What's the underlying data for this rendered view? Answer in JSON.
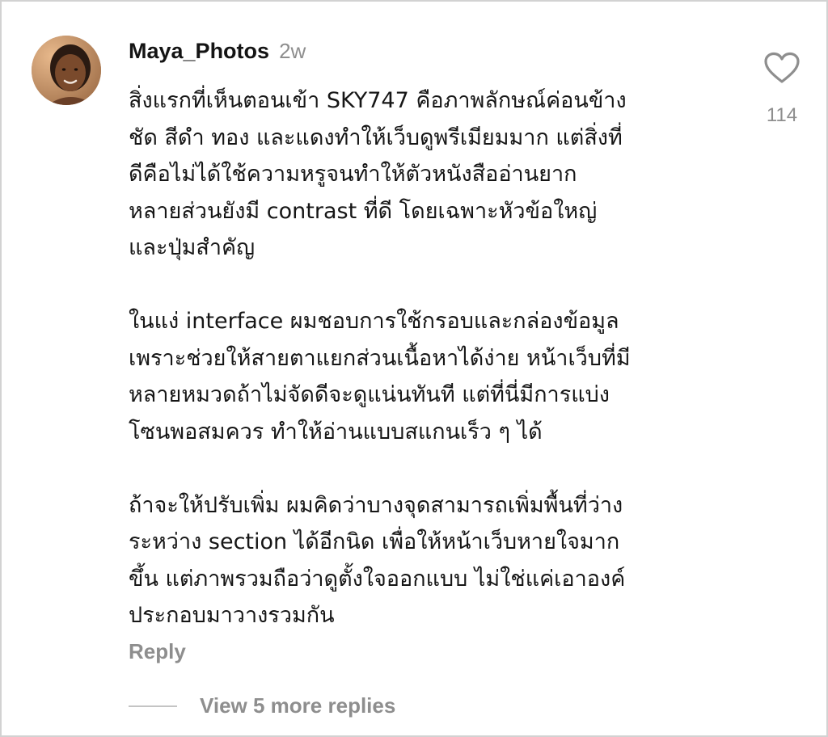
{
  "comment": {
    "username": "Maya_Photos",
    "timestamp": "2w",
    "avatar_icon": "user-avatar-photo",
    "paragraphs": [
      [
        "สิ่งแรกที่เห็นตอนเข้า SKY747 คือภาพลักษณ์ค่อนข้าง",
        "ชัด สีดำ ทอง และแดงทำให้เว็บดูพรีเมียมมาก แต่สิ่งที่",
        "ดีคือไม่ได้ใช้ความหรูจนทำให้ตัวหนังสืออ่านยาก",
        "หลายส่วนยังมี contrast ที่ดี โดยเฉพาะหัวข้อใหญ่",
        "และปุ่มสำคัญ"
      ],
      [
        "ในแง่ interface ผมชอบการใช้กรอบและกล่องข้อมูล",
        "เพราะช่วยให้สายตาแยกส่วนเนื้อหาได้ง่าย หน้าเว็บที่มี",
        "หลายหมวดถ้าไม่จัดดีจะดูแน่นทันที แต่ที่นี่มีการแบ่ง",
        "โซนพอสมควร ทำให้อ่านแบบสแกนเร็ว ๆ ได้"
      ],
      [
        "ถ้าจะให้ปรับเพิ่ม ผมคิดว่าบางจุดสามารถเพิ่มพื้นที่ว่าง",
        "ระหว่าง section ได้อีกนิด เพื่อให้หน้าเว็บหายใจมาก",
        "ขึ้น แต่ภาพรวมถือว่าดูตั้งใจออกแบบ ไม่ใช่แค่เอาองค์",
        "ประกอบมาวางรวมกัน"
      ]
    ],
    "like_icon": "heart-outline-icon",
    "like_count": "114",
    "reply_label": "Reply",
    "view_replies_label": "View 5 more replies"
  },
  "colors": {
    "text": "#141414",
    "muted": "#8e8e8e",
    "background": "#ffffff",
    "divider": "#c4c4c4"
  }
}
